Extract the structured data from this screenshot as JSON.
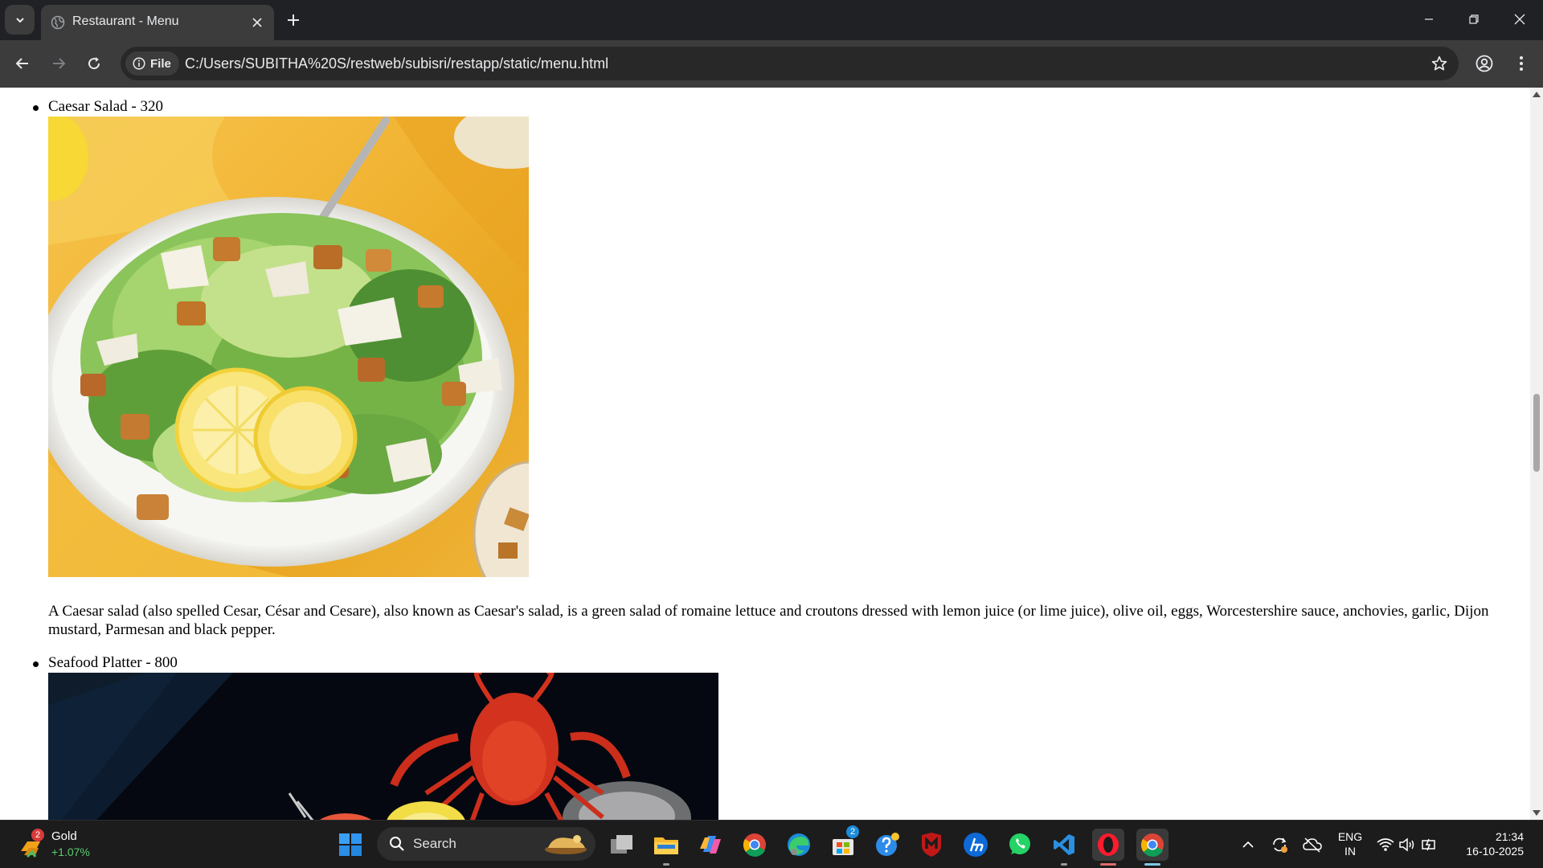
{
  "browser": {
    "tab_title": "Restaurant - Menu",
    "url": "C:/Users/SUBITHA%20S/restweb/subisri/restapp/static/menu.html",
    "file_chip_label": "File"
  },
  "menu": {
    "items": [
      {
        "title": "Caesar Salad - 320",
        "description": "A Caesar salad (also spelled Cesar, César and Cesare), also known as Caesar's salad, is a green salad of romaine lettuce and croutons dressed with lemon juice (or lime juice), olive oil, eggs, Worcestershire sauce, anchovies, garlic, Dijon mustard, Parmesan and black pepper."
      },
      {
        "title": "Seafood Platter - 800"
      }
    ]
  },
  "taskbar": {
    "weather_title": "Gold",
    "weather_change": "+1.07%",
    "weather_badge": "2",
    "search_label": "Search",
    "store_badge": "2",
    "lang_top": "ENG",
    "lang_bottom": "IN",
    "time": "21:34",
    "date": "16-10-2025"
  },
  "colors": {
    "chrome_dark": "#202124",
    "toolbar": "#3c3c3c",
    "taskbar": "#1c1c1c",
    "gain_green": "#5ccd72"
  }
}
